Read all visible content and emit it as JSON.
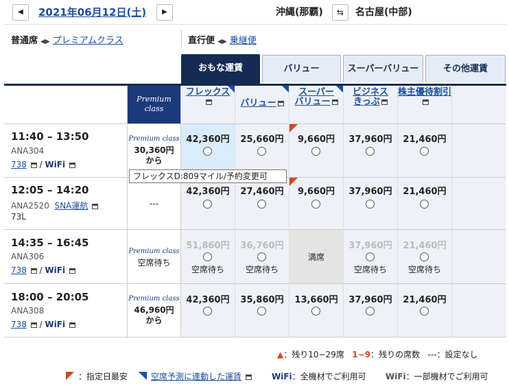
{
  "header": {
    "date": "2021年06月12日(土)",
    "prev_icon": "chevron-left-icon",
    "next_icon": "chevron-right-icon",
    "from": "沖縄(那覇)",
    "to": "名古屋(中部)",
    "swap_icon": "swap-icon"
  },
  "seat_class": {
    "current": "普通席",
    "other": "プレミアムクラス"
  },
  "route_type": {
    "current": "直行便",
    "other": "乗継便"
  },
  "tabs": [
    "おもな運賃",
    "バリュー",
    "スーパーバリュー",
    "その他運賃"
  ],
  "premium_header": [
    "Premium",
    "class"
  ],
  "fare_headers": [
    {
      "line1": "フレックス",
      "line2": ""
    },
    {
      "line1": "バリュー",
      "line2": ""
    },
    {
      "line1": "スーパー",
      "line2": "バリュー"
    },
    {
      "line1": "ビジネス",
      "line2": "きっぷ"
    },
    {
      "line1": "株主優待割引",
      "line2": ""
    }
  ],
  "flights": [
    {
      "time": "11:40 – 13:50",
      "flight_no": "ANA304",
      "aircraft": "738",
      "extra": "WiFi",
      "premium_logo": "Premium class",
      "premium_price": "30,360円",
      "premium_suffix": "から",
      "fares": [
        "42,360円",
        "25,660円",
        "9,660円",
        "37,960円",
        "21,460円"
      ]
    },
    {
      "time": "12:05 – 14:20",
      "flight_no": "ANA2520",
      "codeshare": "SNA運航",
      "aircraft": "73L",
      "premium_text": "---",
      "fares": [
        "42,360円",
        "27,460円",
        "9,660円",
        "37,960円",
        "21,460円"
      ]
    },
    {
      "time": "14:35 – 16:45",
      "flight_no": "ANA306",
      "aircraft": "738",
      "extra": "WiFi",
      "premium_logo": "Premium class",
      "premium_text": "空席待ち",
      "fares": [
        "51,860円",
        "36,760円",
        "満席",
        "37,960円",
        "21,460円"
      ],
      "waitlist": "空席待ち"
    },
    {
      "time": "18:00 – 20:05",
      "flight_no": "ANA308",
      "aircraft": "738",
      "extra": "WiFi",
      "premium_logo": "Premium class",
      "premium_price": "46,960円",
      "premium_suffix": "から",
      "fares": [
        "42,360円",
        "35,860円",
        "13,660円",
        "37,960円",
        "21,460円"
      ]
    }
  ],
  "tooltip": "フレックスD:809マイル/予約変更可",
  "legend": {
    "seats_low": "：残り10−29席",
    "seats_num_label": "1−9",
    "seats_num": "：残りの席数",
    "not_set_label": "---",
    "not_set": "：設定なし",
    "cheapest": "：指定日最安",
    "linked_label": "空席予測に連動した運賃",
    "wifi_all_label": "WiFi",
    "wifi_all": "：全機材でご利用可",
    "wifi_some_label": "WiFi",
    "wifi_some": "：一部機材でご利用可"
  },
  "colors": {
    "navy": "#152b55",
    "link": "#1a4fa0",
    "red": "#d9441b",
    "selected": "#d8ecfb"
  }
}
